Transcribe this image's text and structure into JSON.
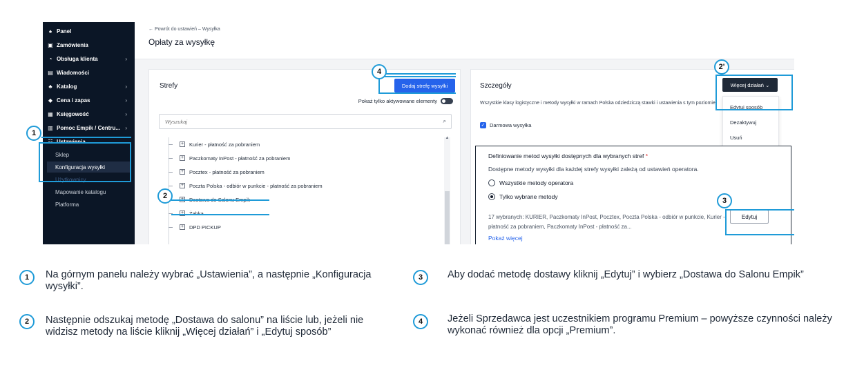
{
  "sidebar": {
    "items": [
      {
        "label": "Panel",
        "icon": "home-icon",
        "glyph": "♠"
      },
      {
        "label": "Zamówienia",
        "icon": "clipboard-icon",
        "glyph": "▣"
      },
      {
        "label": "Obsługa klienta",
        "icon": "headset-icon",
        "glyph": "◔"
      },
      {
        "label": "Wiadomości",
        "icon": "message-icon",
        "glyph": "▤"
      },
      {
        "label": "Katalog",
        "icon": "catalog-icon",
        "glyph": "♣"
      },
      {
        "label": "Cena i zapas",
        "icon": "tag-icon",
        "glyph": "◆"
      },
      {
        "label": "Księgowość",
        "icon": "document-icon",
        "glyph": "▦"
      },
      {
        "label": "Pomoc Empik / Centru...",
        "icon": "help-icon",
        "glyph": "▥"
      },
      {
        "label": "Ustawienia",
        "icon": "settings-icon",
        "glyph": "☷"
      }
    ],
    "sub_items": [
      {
        "label": "Sklep"
      },
      {
        "label": "Konfiguracja wysyłki"
      },
      {
        "label": "Użytkownicy"
      },
      {
        "label": "Mapowanie katalogu"
      },
      {
        "label": "Platforma"
      }
    ],
    "chevron": "›",
    "chevron_down": "⌄"
  },
  "header": {
    "back_link": "← Powrót do ustawień – Wysyłka",
    "title": "Opłaty za wysyłkę"
  },
  "zones": {
    "title": "Strefy",
    "add_button": "Dodaj strefę wysyłki",
    "only_active_label": "Pokaż tylko aktywowane elementy",
    "search_placeholder": "Wyszukaj",
    "search_icon": "⌕",
    "expand_glyph": "+",
    "scroll_up_glyph": "▲",
    "items": [
      {
        "label": "Kurier - płatność za pobraniem"
      },
      {
        "label": "Paczkomaty InPost - płatność za pobraniem"
      },
      {
        "label": "Pocztex - płatność za pobraniem"
      },
      {
        "label": "Poczta Polska - odbiór w punkcie - płatność za pobraniem"
      },
      {
        "label": "Dostawa do Salonu Empik"
      },
      {
        "label": "Żabka"
      },
      {
        "label": "DPD PICKUP"
      }
    ]
  },
  "details": {
    "title": "Szczegóły",
    "more_actions": "Więcej działań ⌄",
    "description": "Wszystkie klasy logistyczne i metody wysyłki w ramach Polska odziedziczą stawki i ustawienia s tym poziomie.",
    "free_shipping": "Darmowa wysyłka",
    "checkmark": "✓",
    "menu": [
      {
        "label": "Edytuj sposób"
      },
      {
        "label": "Dezaktywuj"
      },
      {
        "label": "Usuń"
      }
    ],
    "methods": {
      "heading": "Definiowanie metod wysyłki dostępnych dla wybranych stref",
      "required_mark": "*",
      "subtitle": "Dostępne metody wysyłki dla każdej strefy wysyłki zależą od ustawień operatora.",
      "option_all": "Wszystkie metody operatora",
      "option_selected": "Tylko wybrane metody",
      "summary": "17 wybranych: KURIER, Paczkomaty InPost, Pocztex, Poczta Polska - odbiór w punkcie, Kurier - płatność za pobraniem, Paczkomaty InPost - płatność za...",
      "show_more": "Pokaż więcej",
      "edit_button": "Edytuj"
    }
  },
  "markers": {
    "m1": "1",
    "m2": "2",
    "m2b": "2'",
    "m3": "3",
    "m4": "4"
  },
  "instructions": [
    {
      "number": "1",
      "text": "Na górnym panelu należy wybrać „Ustawienia”, a następnie „Konfiguracja wysyłki”."
    },
    {
      "number": "2",
      "text": "Następnie odszukaj metodę „Dostawa do salonu” na liście lub, jeżeli nie widzisz metody na liście kliknij „Więcej działań”  i „Edytuj sposób”"
    },
    {
      "number": "3",
      "text": "Aby dodać metodę dostawy kliknij „Edytuj” i wybierz „Dostawa do Salonu Empik”"
    },
    {
      "number": "4",
      "text": "Jeżeli Sprzedawca jest uczestnikiem programu Premium – powyższe czynności należy wykonać również dla opcji „Premium”."
    }
  ],
  "colors": {
    "sidebar_bg": "#0b1626",
    "primary": "#2563eb",
    "callout": "#1f9bd8"
  }
}
